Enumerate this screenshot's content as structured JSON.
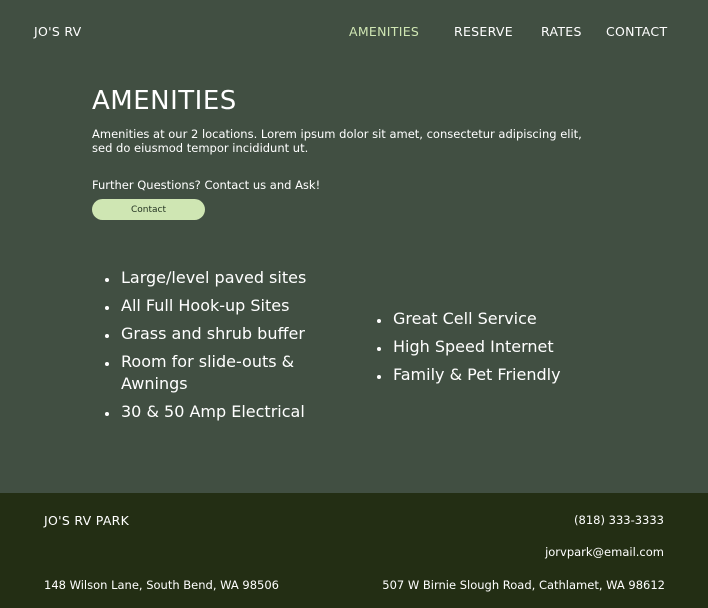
{
  "header": {
    "brand": "JO'S RV",
    "nav": [
      "AMENITIES",
      "RESERVE",
      "RATES",
      "CONTACT"
    ],
    "active": "AMENITIES"
  },
  "main": {
    "title": "AMENITIES",
    "intro": "Amenities at our 2 locations. Lorem ipsum dolor sit amet, consectetur adipiscing elit, sed do eiusmod tempor incididunt ut.",
    "question": "Further Questions? Contact us and Ask!",
    "contact_button": "Contact",
    "amenities_left": [
      "Large/level paved sites",
      "All Full Hook-up Sites",
      "Grass and shrub buffer",
      "Room for slide-outs & Awnings",
      "30 & 50 Amp Electrical"
    ],
    "amenities_right": [
      "Great Cell Service",
      "High Speed Internet",
      "Family & Pet Friendly"
    ]
  },
  "footer": {
    "name": "JO'S RV PARK",
    "phone": "(818) 333-3333",
    "email": "jorvpark@email.com",
    "address_1": "148 Wilson Lane, South Bend, WA 98506",
    "address_2": "507 W Birnie Slough Road, Cathlamet, WA 98612"
  },
  "colors": {
    "background": "#414f42",
    "accent": "#cfe6b3",
    "footer": "#232e14"
  }
}
